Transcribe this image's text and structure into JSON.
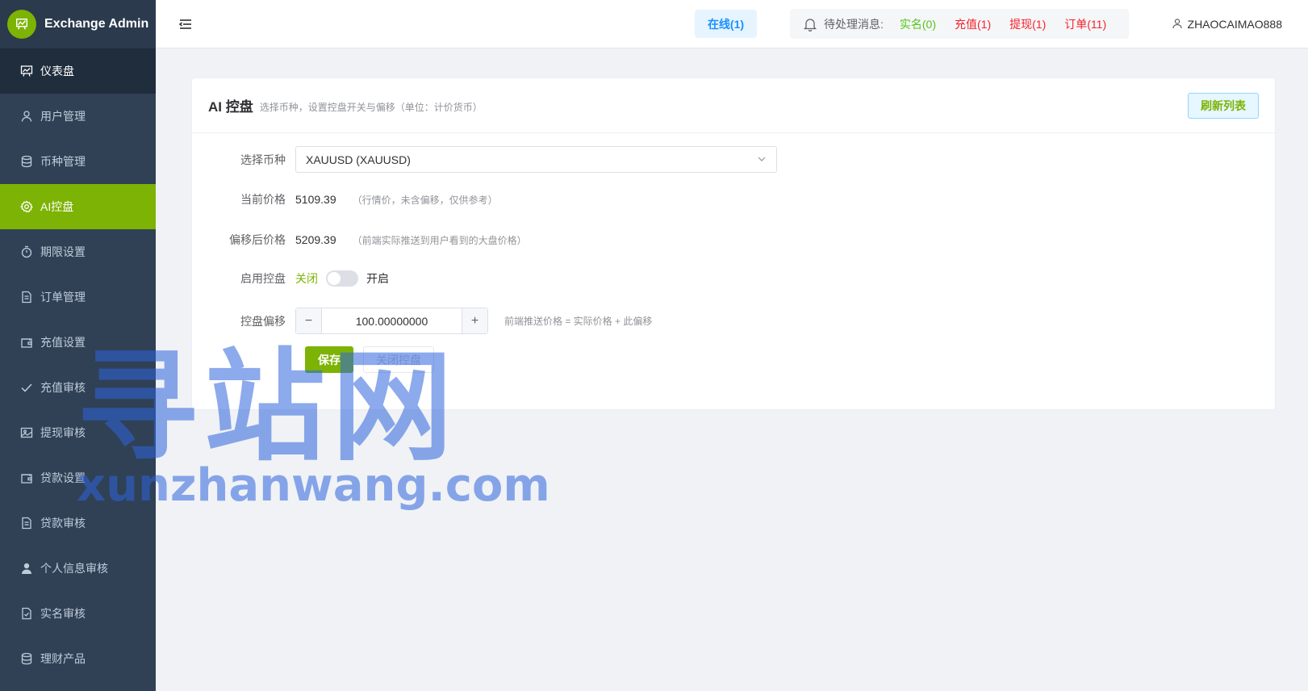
{
  "brand": {
    "title": "Exchange Admin"
  },
  "sidebar": {
    "items": [
      {
        "label": "仪表盘",
        "icon": "chart-icon"
      },
      {
        "label": "用户管理",
        "icon": "user-icon"
      },
      {
        "label": "币种管理",
        "icon": "database-icon"
      },
      {
        "label": "AI控盘",
        "icon": "gear-icon"
      },
      {
        "label": "期限设置",
        "icon": "timer-icon"
      },
      {
        "label": "订单管理",
        "icon": "document-icon"
      },
      {
        "label": "充值设置",
        "icon": "wallet-icon"
      },
      {
        "label": "充值审核",
        "icon": "check-icon"
      },
      {
        "label": "提现审核",
        "icon": "image-icon"
      },
      {
        "label": "贷款设置",
        "icon": "wallet-icon"
      },
      {
        "label": "贷款审核",
        "icon": "document-icon"
      },
      {
        "label": "个人信息审核",
        "icon": "person-icon"
      },
      {
        "label": "实名审核",
        "icon": "document-check-icon"
      },
      {
        "label": "理财产品",
        "icon": "database-icon"
      }
    ]
  },
  "header": {
    "online": "在线(1)",
    "pending_label": "待处理消息:",
    "pending": [
      {
        "label": "实名(0)",
        "color": "#52c41a"
      },
      {
        "label": "充值(1)",
        "color": "#f5222d"
      },
      {
        "label": "提现(1)",
        "color": "#f5222d"
      },
      {
        "label": "订单(11)",
        "color": "#f5222d"
      }
    ],
    "username": "ZHAOCAIMAO888"
  },
  "card": {
    "title": "AI 控盘",
    "subtitle": "选择币种，设置控盘开关与偏移（单位：计价货币）",
    "refresh_label": "刷新列表",
    "form": {
      "symbol_label": "选择币种",
      "symbol_value": "XAUUSD (XAUUSD)",
      "current_price_label": "当前价格",
      "current_price": "5109.39",
      "current_price_hint": "（行情价，未含偏移，仅供参考）",
      "offset_price_label": "偏移后价格",
      "offset_price": "5209.39",
      "offset_price_hint": "（前端实际推送到用户看到的大盘价格）",
      "enable_label": "启用控盘",
      "toggle_off": "关闭",
      "toggle_on": "开启",
      "toggle_state": false,
      "offset_label": "控盘偏移",
      "offset_value": "100.00000000",
      "offset_hint": "前端推送价格 = 实际价格 + 此偏移",
      "save_label": "保存",
      "close_label": "关闭控盘"
    }
  },
  "watermark": {
    "big": "寻站网",
    "small": "xunzhanwang.com"
  },
  "colors": {
    "accent": "#7cb305",
    "sidebar": "#304156",
    "online": "#1890ff"
  }
}
